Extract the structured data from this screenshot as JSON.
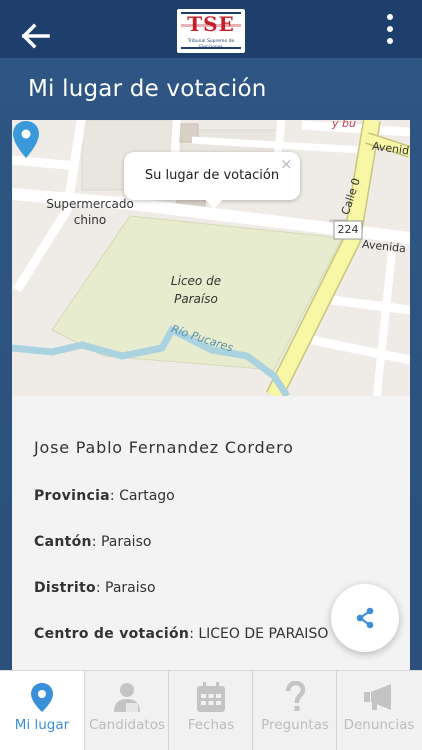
{
  "header": {
    "logo_text": "TSE",
    "logo_subtitle": "Tribunal Supremo de Elecciones",
    "icons": {
      "back": "arrow-left-icon",
      "menu": "more-vertical-icon"
    }
  },
  "page": {
    "title": "Mi lugar de votación"
  },
  "map": {
    "popup_text": "Su lugar de votación",
    "popup_close": "×",
    "labels": {
      "market_line1": "Supermercado",
      "market_line2": "chino",
      "school_line1": "Liceo de",
      "school_line2": "Paraíso",
      "river": "Río Pucares",
      "street_calle": "Calle 0",
      "avenida_top": "Avenid",
      "avenida_mid": "Avenida",
      "route": "224",
      "corner_text": "y bu"
    },
    "colors": {
      "pin": "#3a9ad9",
      "main_road": "#f7f7a6",
      "park": "#e8ecce",
      "river": "#aad3df"
    }
  },
  "details": {
    "name": "Jose Pablo Fernandez Cordero",
    "provincia_label": "Provincia",
    "provincia_value": ": Cartago",
    "canton_label": "Cantón",
    "canton_value": ": Paraiso",
    "distrito_label": "Distrito",
    "distrito_value": ": Paraiso",
    "centro_label": "Centro de votación",
    "centro_value": ": LICEO DE PARAISO"
  },
  "tabs": [
    {
      "label": "Mi lugar",
      "icon": "map-pin-icon",
      "active": true
    },
    {
      "label": "Candidatos",
      "icon": "candidate-icon",
      "active": false
    },
    {
      "label": "Fechas",
      "icon": "calendar-icon",
      "active": false
    },
    {
      "label": "Preguntas",
      "icon": "question-icon",
      "active": false
    },
    {
      "label": "Denuncias",
      "icon": "megaphone-icon",
      "active": false
    }
  ],
  "colors": {
    "header": "#1e3f6c",
    "background": "#2f5684",
    "accent": "#3a8fd8"
  }
}
